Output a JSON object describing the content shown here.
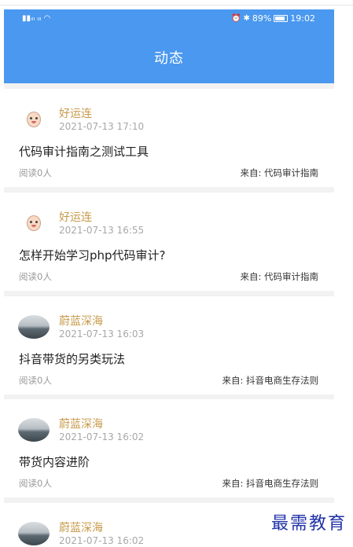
{
  "status_bar": {
    "left_text": "HD ⁴⁶ ⁴⁶",
    "battery": "89%",
    "time": "19:02"
  },
  "header": {
    "title": "动态"
  },
  "posts": [
    {
      "author": "好运连",
      "time": "2021-07-13 17:10",
      "title": "代码审计指南之测试工具",
      "reads": "阅读0人",
      "source": "来自: 代码审计指南",
      "avatar": "cartoon"
    },
    {
      "author": "好运连",
      "time": "2021-07-13 16:55",
      "title": "怎样开始学习php代码审计?",
      "reads": "阅读0人",
      "source": "来自: 代码审计指南",
      "avatar": "cartoon"
    },
    {
      "author": "蔚蓝深海",
      "time": "2021-07-13 16:03",
      "title": "抖音带货的另类玩法",
      "reads": "阅读0人",
      "source": "来自: 抖音电商生存法则",
      "avatar": "photo"
    },
    {
      "author": "蔚蓝深海",
      "time": "2021-07-13 16:02",
      "title": "带货内容进阶",
      "reads": "阅读0人",
      "source": "来自: 抖音电商生存法则",
      "avatar": "photo"
    },
    {
      "author": "蔚蓝深海",
      "time": "2021-07-13 16:02",
      "title": "",
      "reads": "",
      "source": "",
      "avatar": "photo"
    }
  ],
  "watermark": "最需教育"
}
